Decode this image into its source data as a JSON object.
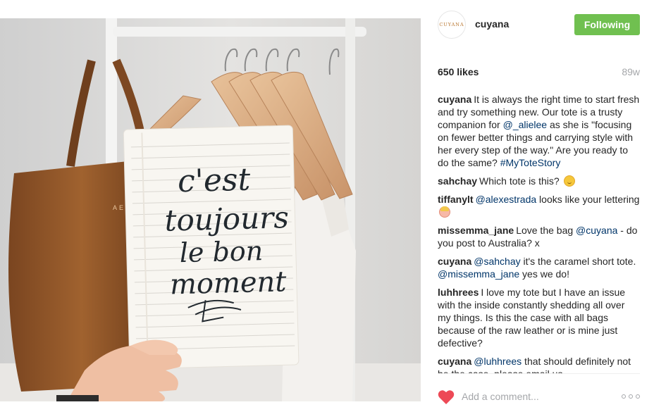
{
  "post": {
    "author_avatar_text": "CUYANA",
    "author": "cuyana",
    "follow_label": "Following",
    "follow_color": "#70c050",
    "likes": "650 likes",
    "age": "89w"
  },
  "photo": {
    "description_icon": "photo",
    "notebook_text": [
      "c'est",
      "toujours",
      "le bon",
      "moment"
    ],
    "bag_monogram": "AEL"
  },
  "comments": [
    {
      "user": "cuyana",
      "parts": [
        {
          "t": "It is always the right time to start fresh and try something new. Our tote is a trusty companion for "
        },
        {
          "m": "@_alielee"
        },
        {
          "t": " as she is \"focusing on fewer better things and carrying style with her every step of the way.\" Are you ready to do the same? "
        },
        {
          "m": "#MyToteStory"
        }
      ]
    },
    {
      "user": "sahchay",
      "parts": [
        {
          "t": "Which tote is this? "
        },
        {
          "e": "smile"
        }
      ]
    },
    {
      "user": "tiffanylt",
      "parts": [
        {
          "m": "@alexestrada"
        },
        {
          "t": " looks like your lettering "
        },
        {
          "e": "face"
        }
      ]
    },
    {
      "user": "missemma_jane",
      "parts": [
        {
          "t": "Love the bag "
        },
        {
          "m": "@cuyana"
        },
        {
          "t": " - do you post to Australia? x"
        }
      ]
    },
    {
      "user": "cuyana",
      "parts": [
        {
          "m": "@sahchay"
        },
        {
          "t": " it's the caramel short tote. "
        },
        {
          "m": "@missemma_jane"
        },
        {
          "t": " yes we do!"
        }
      ]
    },
    {
      "user": "luhhrees",
      "parts": [
        {
          "t": "I love my tote but I have an issue with the inside constantly shedding all over my things. Is this the case with all bags because of the raw leather or is mine just defective?"
        }
      ]
    },
    {
      "user": "cuyana",
      "parts": [
        {
          "m": "@luhhrees"
        },
        {
          "t": " that should definitely not be the case, please email us."
        }
      ]
    }
  ],
  "footer": {
    "heart_color": "#ed4956",
    "comment_placeholder": "Add a comment...",
    "heart_icon": "heart-icon",
    "more_icon": "more-options-icon"
  }
}
